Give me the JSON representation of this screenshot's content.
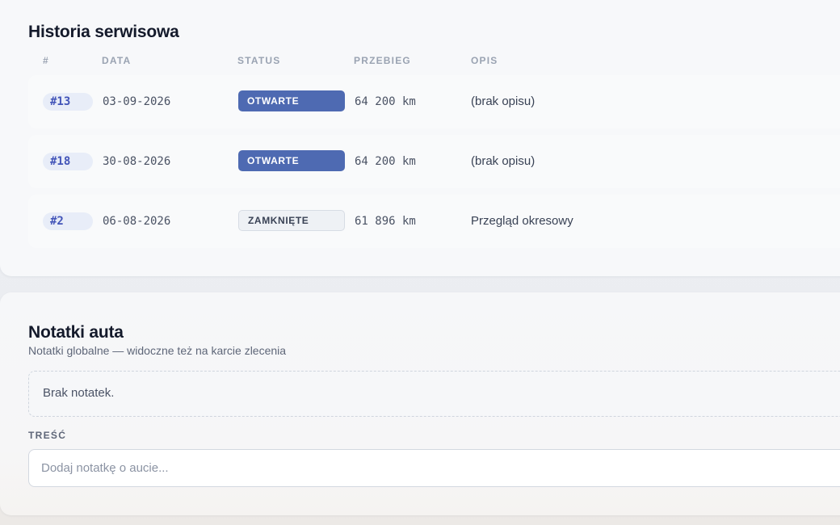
{
  "history": {
    "title": "Historia serwisowa",
    "columns": [
      "#",
      "DATA",
      "STATUS",
      "PRZEBIEG",
      "OPIS"
    ],
    "rows": [
      {
        "id": "#13",
        "date": "03-09-2026",
        "status": "OTWARTE",
        "mileage": "64 200 km",
        "description": "(brak opisu)"
      },
      {
        "id": "#18",
        "date": "30-08-2026",
        "status": "OTWARTE",
        "mileage": "64 200 km",
        "description": "(brak opisu)"
      },
      {
        "id": "#2",
        "date": "06-08-2026",
        "status": "ZAMKNIĘTE",
        "mileage": "61 896 km",
        "description": "Przegląd okresowy"
      }
    ]
  },
  "notes": {
    "title": "Notatki auta",
    "subtitle": "Notatki globalne — widoczne też na karcie zlecenia",
    "empty_text": "Brak notatek.",
    "field_label": "TREŚĆ",
    "input_value": "",
    "input_placeholder": "Dodaj notatkę o aucie..."
  },
  "colors": {
    "status_open": "#4e6ab2",
    "status_closed": "#eef1f5",
    "id_pill_text": "#4254b8"
  }
}
